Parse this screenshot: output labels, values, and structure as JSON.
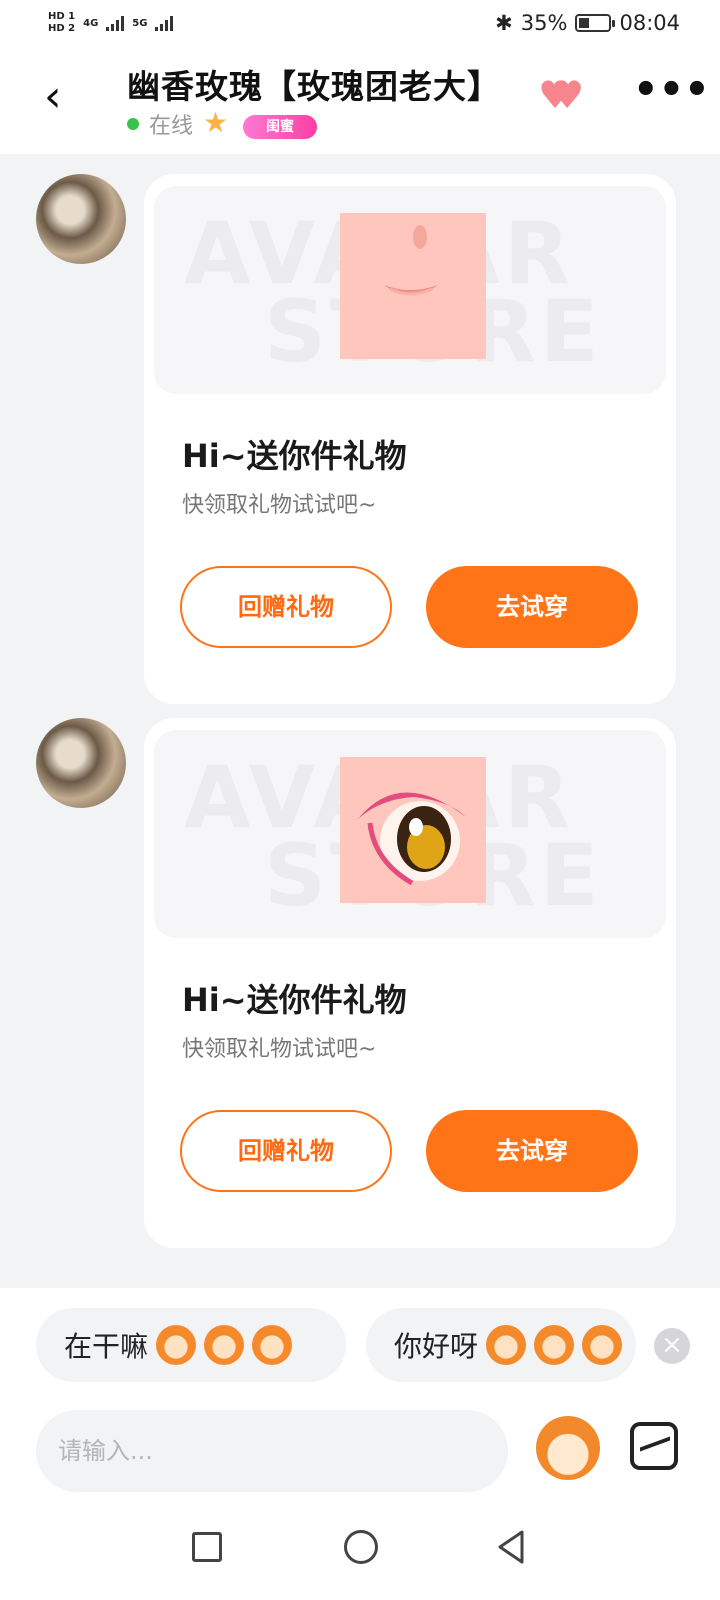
{
  "status_bar": {
    "sim1": "HD 1",
    "sim2": "HD 2",
    "net1": "4G",
    "net2": "5G",
    "battery": "35%",
    "battery_level": 0.35,
    "time": "08:04"
  },
  "header": {
    "back_icon": "chevron-left-icon",
    "title": "幽香玫瑰【玫瑰团老大】",
    "status": "在线",
    "badge": "闺蜜",
    "more_icon": "more-dots-icon"
  },
  "messages": [
    {
      "title": "Hi~送你件礼物",
      "desc": "快领取礼物试试吧~",
      "watermark": [
        "AVATAR",
        "STORE"
      ],
      "return_gift_label": "回赠礼物",
      "try_on_label": "去试穿"
    },
    {
      "title": "Hi~送你件礼物",
      "desc": "快领取礼物试试吧~",
      "watermark": [
        "AVATAR",
        "STORE"
      ],
      "return_gift_label": "回赠礼物",
      "try_on_label": "去试穿"
    }
  ],
  "quick_replies": [
    {
      "text": "在干嘛"
    },
    {
      "text": "你好呀"
    }
  ],
  "input": {
    "placeholder": "请输入..."
  },
  "colors": {
    "accent": "#ff7416",
    "online": "#37c24a",
    "badge": "#ff3ea5"
  }
}
